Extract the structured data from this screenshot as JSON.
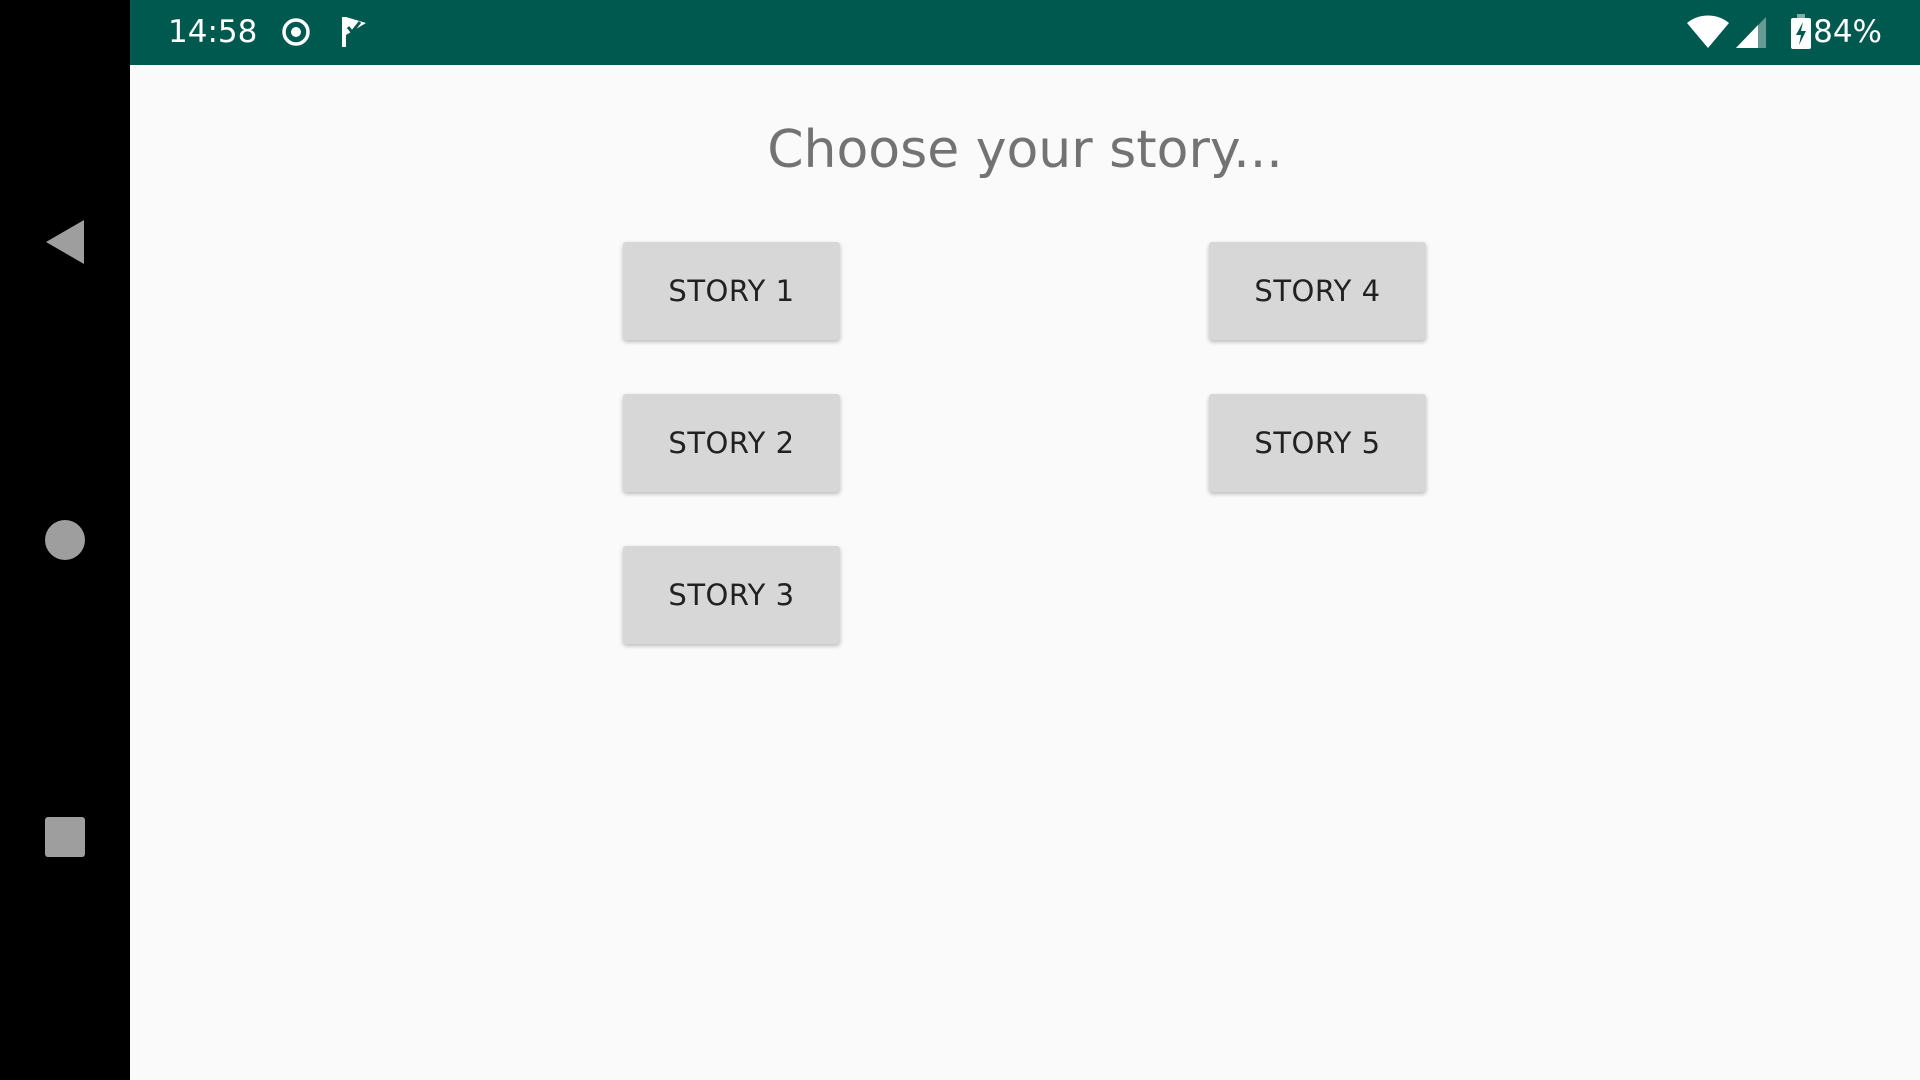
{
  "status_bar": {
    "time": "14:58",
    "battery_percent": "84%",
    "icons": [
      "target-icon",
      "check-flag-icon",
      "wifi-icon",
      "signal-icon",
      "battery-charging-icon"
    ],
    "background_color": "#00594f"
  },
  "navigation_bar": {
    "buttons": [
      "back-icon",
      "home-icon",
      "recents-icon"
    ]
  },
  "main": {
    "title": "Choose your story...",
    "buttons": {
      "story1": "STORY 1",
      "story2": "STORY 2",
      "story3": "STORY 3",
      "story4": "STORY 4",
      "story5": "STORY 5"
    }
  }
}
